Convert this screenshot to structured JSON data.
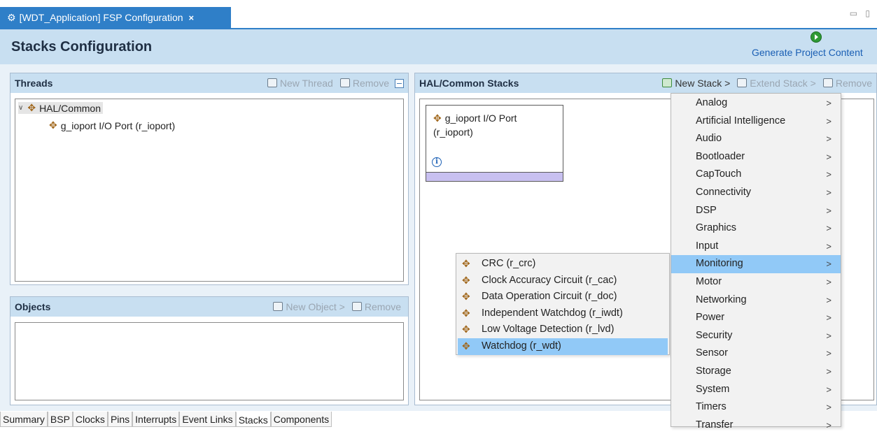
{
  "editor_tab": {
    "title": "[WDT_Application] FSP Configuration",
    "close": "×"
  },
  "header": {
    "title": "Stacks Configuration",
    "generate_label": "Generate Project Content"
  },
  "threads": {
    "title": "Threads",
    "new_thread": "New Thread",
    "remove": "Remove",
    "tree": [
      {
        "label": "HAL/Common"
      },
      {
        "label": "g_ioport I/O Port (r_ioport)"
      }
    ]
  },
  "objects": {
    "title": "Objects",
    "new_object": "New Object >",
    "remove": "Remove"
  },
  "hal_stacks": {
    "title": "HAL/Common Stacks",
    "new_stack": "New Stack >",
    "extend_stack": "Extend Stack >",
    "remove": "Remove",
    "module": {
      "line1": "g_ioport I/O Port",
      "line2": "(r_ioport)",
      "info": "i"
    }
  },
  "category_menu": {
    "items": [
      "Analog",
      "Artificial Intelligence",
      "Audio",
      "Bootloader",
      "CapTouch",
      "Connectivity",
      "DSP",
      "Graphics",
      "Input",
      "Monitoring",
      "Motor",
      "Networking",
      "Power",
      "Security",
      "Sensor",
      "Storage",
      "System",
      "Timers",
      "Transfer"
    ],
    "highlighted": "Monitoring",
    "arrow": ">"
  },
  "monitoring_submenu": {
    "items": [
      "CRC (r_crc)",
      "Clock Accuracy Circuit (r_cac)",
      "Data Operation Circuit (r_doc)",
      "Independent Watchdog (r_iwdt)",
      "Low Voltage Detection (r_lvd)",
      "Watchdog (r_wdt)"
    ],
    "highlighted": "Watchdog (r_wdt)"
  },
  "bottom_tabs": {
    "items": [
      "Summary",
      "BSP",
      "Clocks",
      "Pins",
      "Interrupts",
      "Event Links",
      "Stacks",
      "Components"
    ],
    "active": "Stacks"
  },
  "colors": {
    "tab_blue": "#2f7fc8",
    "header_band": "#c8dff1",
    "menu_highlight": "#91c9f7",
    "module_bar": "#c8c0f0"
  }
}
